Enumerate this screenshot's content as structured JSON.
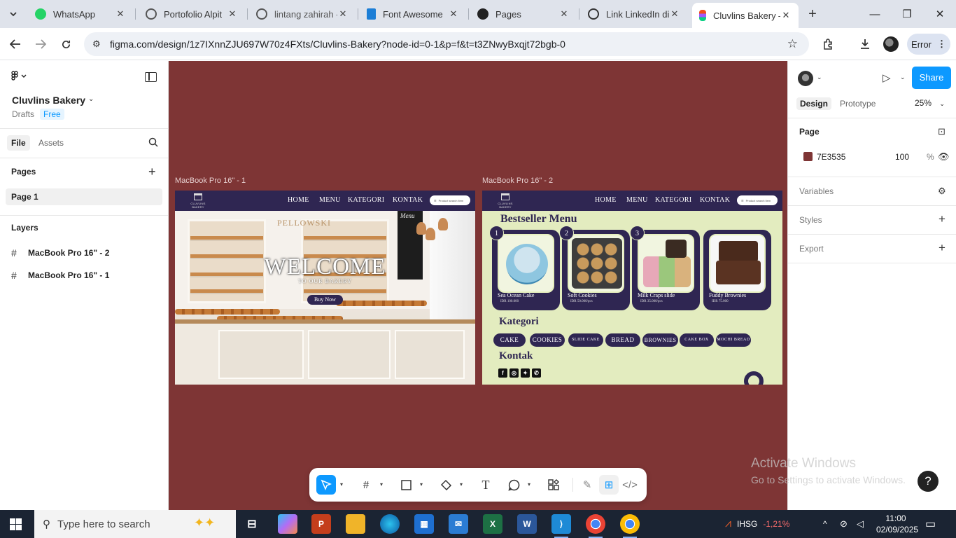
{
  "browser": {
    "tabs": [
      {
        "label": "WhatsApp",
        "icon": "whatsapp-icon",
        "color": "#25d366"
      },
      {
        "label": "Portofolio Alpit",
        "icon": "globe-icon",
        "color": "#555555"
      },
      {
        "label": "lintang zahirah -",
        "icon": "globe-icon",
        "color": "#555555"
      },
      {
        "label": "Font Awesome",
        "icon": "flag-icon",
        "color": "#1c7ed6"
      },
      {
        "label": "Pages",
        "icon": "github-icon",
        "color": "#222222"
      },
      {
        "label": "Link LinkedIn di",
        "icon": "openai-icon",
        "color": "#333333"
      },
      {
        "label": "Cluvlins Bakery –",
        "icon": "figma-icon",
        "color": "#f24e1e"
      }
    ],
    "url": "figma.com/design/1z7IXnnZJU697W70z4FXts/Cluvlins-Bakery?node-id=0-1&p=f&t=t3ZNwyBxqjt72bgb-0",
    "profile_button": "Error"
  },
  "left_panel": {
    "file_name": "Cluvlins Bakery",
    "drafts": "Drafts",
    "plan": "Free",
    "tabs": [
      "File",
      "Assets"
    ],
    "pages_heading": "Pages",
    "pages": [
      "Page 1"
    ],
    "layers_heading": "Layers",
    "layers": [
      "MacBook Pro 16\" - 2",
      "MacBook Pro 16\" - 1"
    ]
  },
  "canvas": {
    "background": "#7E3535",
    "frame1": {
      "label": "MacBook Pro 16\" - 1",
      "logo_text": "CLUVLINS BAKERY",
      "nav": [
        "HOME",
        "MENU",
        "KATEGORI",
        "KONTAK"
      ],
      "search_placeholder": "Product search item",
      "hero_title": "WELCOME",
      "hero_subtitle": "TO OUR BAKERY",
      "cta": "Buy Now",
      "shop_sign": "PELLOWSKI",
      "menu_board": "Menu"
    },
    "frame2": {
      "label": "MacBook Pro 16\" - 2",
      "logo_text": "CLUVLINS BAKERY",
      "nav": [
        "HOME",
        "MENU",
        "KATEGORI",
        "KONTAK"
      ],
      "search_placeholder": "Product search item",
      "bestseller_heading": "Bestseller Menu",
      "products": [
        {
          "rank": "1",
          "name": "Sea Ocean Cake",
          "price": "IDR 100.000"
        },
        {
          "rank": "2",
          "name": "Soft Cookies",
          "price": "IDR 50.000/pcs"
        },
        {
          "rank": "3",
          "name": "Milk Craps slide",
          "price": "IDR 35.000/pcs"
        },
        {
          "rank": "",
          "name": "Fuddy Brownies",
          "price": "IDR 75.000"
        }
      ],
      "kategori_heading": "Kategori",
      "categories": [
        "CAKE",
        "COOKIES",
        "SLIDE CAKE",
        "BREAD",
        "BROWNIES",
        "CAKE BOX",
        "MOCHI BREAD"
      ],
      "kontak_heading": "Kontak",
      "socials": [
        "facebook-icon",
        "instagram-icon",
        "twitter-icon",
        "whatsapp-icon"
      ]
    }
  },
  "right_panel": {
    "share": "Share",
    "tabs": [
      "Design",
      "Prototype"
    ],
    "zoom": "25%",
    "page_heading": "Page",
    "page_fill_hex": "7E3535",
    "page_fill_opacity": "100",
    "opacity_unit": "%",
    "sections": [
      "Variables",
      "Styles",
      "Export"
    ]
  },
  "watermark": {
    "line1": "Activate Windows",
    "line2": "Go to Settings to activate Windows."
  },
  "taskbar": {
    "search_placeholder": "Type here to search",
    "stock_name": "IHSG",
    "stock_change": "-1,21%",
    "time": "11:00",
    "date": "02/09/2025"
  }
}
